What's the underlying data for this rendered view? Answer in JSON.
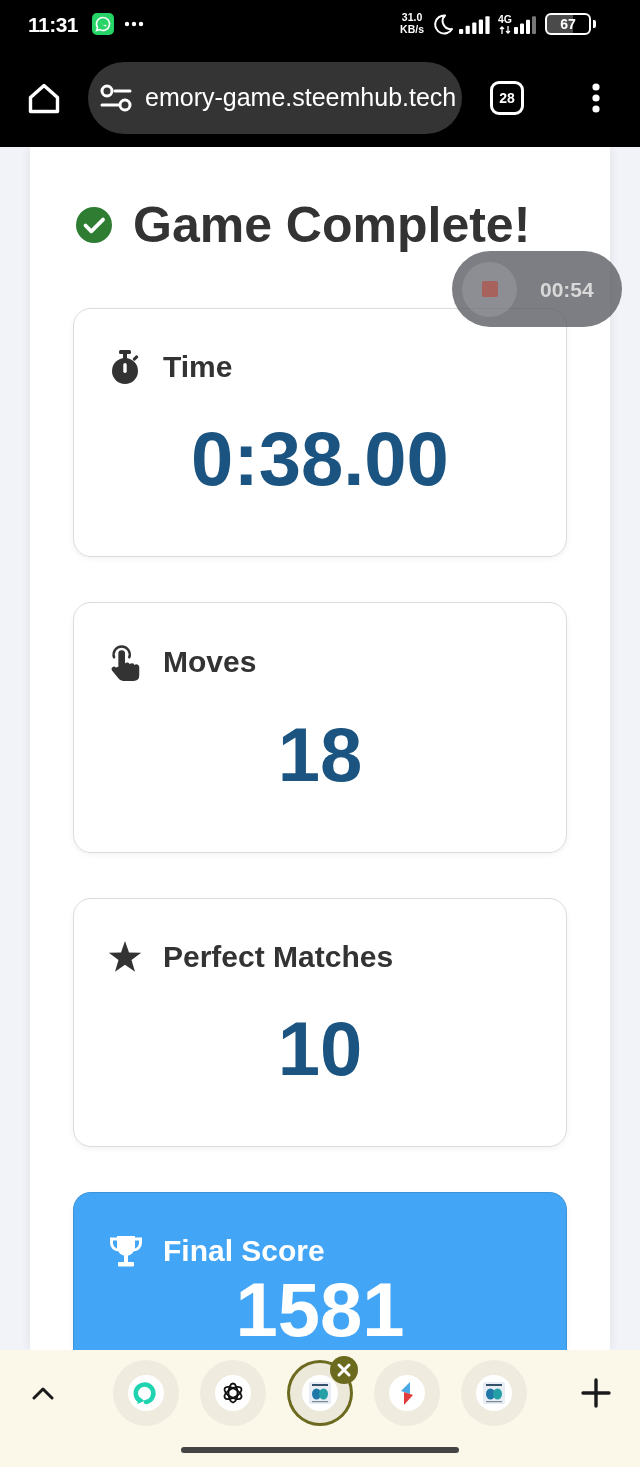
{
  "status_bar": {
    "time": "11:31",
    "network_speed": "31.0",
    "network_speed_unit": "KB/s",
    "network_type": "4G",
    "battery": "67"
  },
  "browser_bar": {
    "url": "emory-game.steemhub.tech",
    "tab_count": "28"
  },
  "screen_recorder": {
    "elapsed": "00:54"
  },
  "page": {
    "title": "Game Complete!",
    "stats": [
      {
        "kind": "time",
        "label": "Time",
        "value": "0:38.00",
        "highlight": false
      },
      {
        "kind": "moves",
        "label": "Moves",
        "value": "18",
        "highlight": false
      },
      {
        "kind": "matches",
        "label": "Perfect Matches",
        "value": "10",
        "highlight": false
      },
      {
        "kind": "score",
        "label": "Final Score",
        "value": "1581",
        "highlight": true
      }
    ]
  },
  "tab_strip": {
    "tabs": [
      {
        "kind": "chat",
        "selected": false
      },
      {
        "kind": "loops",
        "selected": false
      },
      {
        "kind": "thumbnail",
        "selected": true
      },
      {
        "kind": "zigzag",
        "selected": false
      },
      {
        "kind": "thumbnail",
        "selected": false
      }
    ]
  }
}
